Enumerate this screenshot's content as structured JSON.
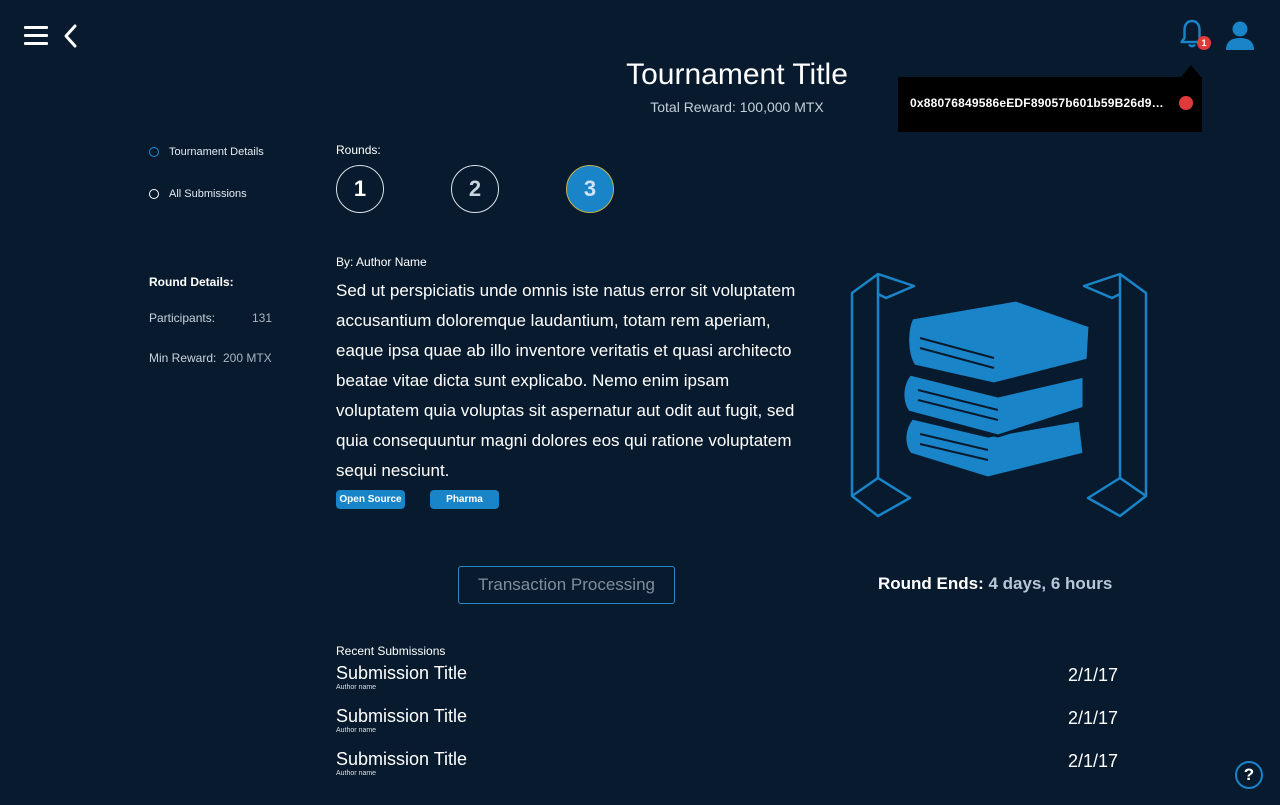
{
  "icons": {
    "menu": "hamburger-menu-icon",
    "back": "chevron-left-icon",
    "notifications": "bell-icon",
    "account": "user-icon",
    "help": "question-icon",
    "illustration": "books-stack-icon"
  },
  "colors": {
    "background": "#081b2e",
    "accent": "#1a84c9",
    "alert": "#e03a3a"
  },
  "header": {
    "notification_count": "1"
  },
  "wallet": {
    "address": "0x88076849586eEDF89057b601b59B26d9…",
    "status_color": "#e03a3a"
  },
  "tournament": {
    "title": "Tournament Title",
    "total_reward": "Total Reward: 100,000 MTX"
  },
  "sidebar": {
    "nav": [
      {
        "label": "Tournament Details",
        "active": true
      },
      {
        "label": "All Submissions",
        "active": false
      }
    ],
    "round_details": {
      "heading": "Round Details:",
      "participants_label": "Participants:",
      "participants_value": "131",
      "min_reward_label": "Min Reward:",
      "min_reward_value": "200 MTX"
    }
  },
  "rounds": {
    "label": "Rounds:",
    "items": [
      "1",
      "2",
      "3"
    ],
    "selected": "3"
  },
  "round": {
    "author": "By: Author Name",
    "description": "Sed ut perspiciatis unde omnis iste natus error sit voluptatem accusantium doloremque laudantium, totam rem aperiam, eaque ipsa quae ab illo inventore veritatis et quasi architecto beatae vitae dicta sunt explicabo. Nemo enim ipsam voluptatem quia voluptas sit aspernatur aut odit aut fugit, sed quia consequuntur magni dolores eos qui ratione voluptatem sequi nesciunt.",
    "tags": [
      "Open Source",
      "Pharma"
    ]
  },
  "actions": {
    "transaction_label": "Transaction Processing",
    "round_ends_label": "Round Ends:",
    "round_ends_value": "4 days, 6 hours"
  },
  "submissions": {
    "heading": "Recent Submissions",
    "items": [
      {
        "title": "Submission Title",
        "author": "Author name",
        "date": "2/1/17"
      },
      {
        "title": "Submission Title",
        "author": "Author name",
        "date": "2/1/17"
      },
      {
        "title": "Submission Title",
        "author": "Author name",
        "date": "2/1/17"
      }
    ]
  },
  "help": {
    "label": "?"
  }
}
